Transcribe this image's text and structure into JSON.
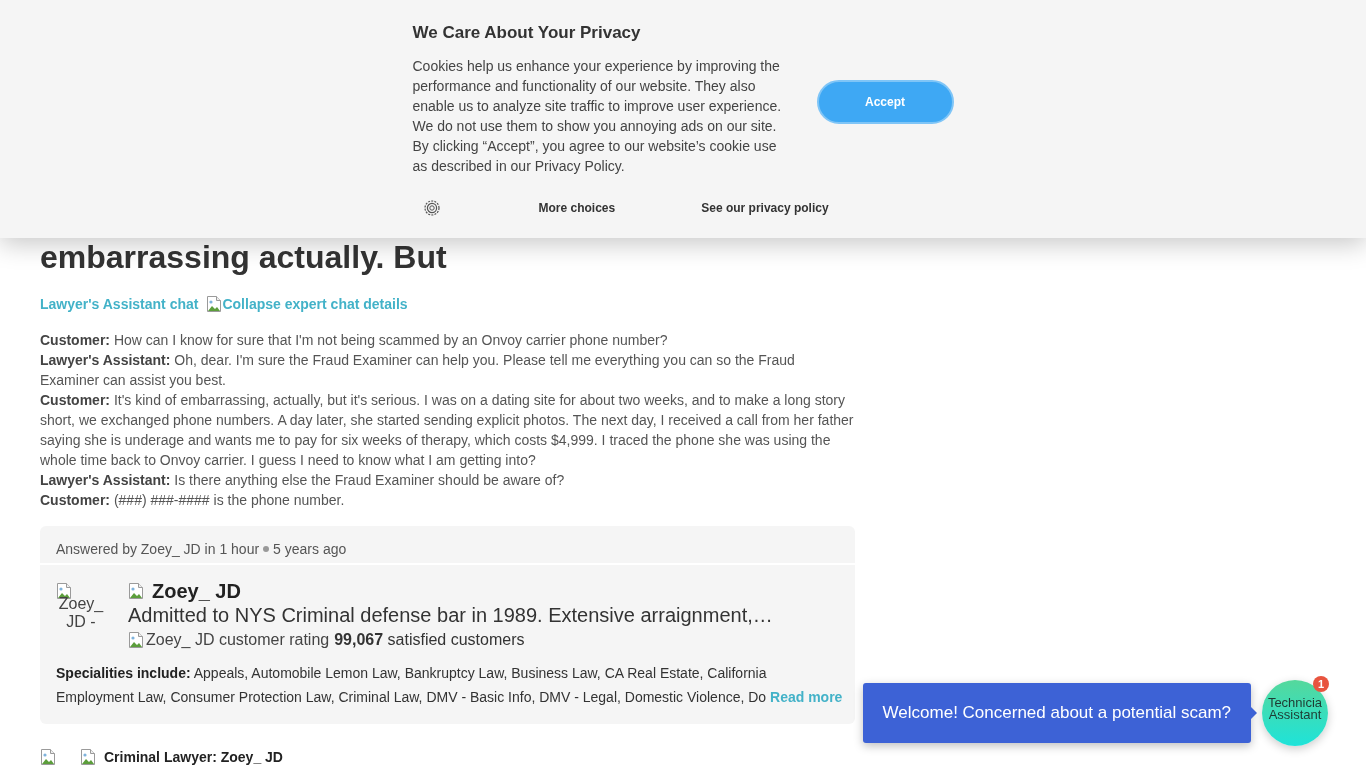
{
  "cookie_banner": {
    "title": "We Care About Your Privacy",
    "body": "Cookies help us enhance your experience by improving the performance and functionality of our website. They also enable us to analyze site traffic to improve user experience. We do not use them to show you annoying ads on our site. By clicking “Accept”, you agree to our website’s cookie use as described in our Privacy Policy.",
    "accept_button": "Accept",
    "links": [
      "More choices",
      "See our privacy policy"
    ]
  },
  "question": {
    "heading": "embarrassing actually. But",
    "chat_link": "Lawyer's Assistant chat",
    "collapse_image_alt": "Collapse expert chat details",
    "transcript": [
      {
        "speaker": "Customer:",
        "text": "How can I know for sure that I'm not being scammed by an Onvoy carrier phone number?"
      },
      {
        "speaker": "Lawyer's Assistant:",
        "text": "Oh, dear. I'm sure the Fraud Examiner can help you. Please tell me everything you can so the Fraud Examiner can assist you best."
      },
      {
        "speaker": "Customer:",
        "text": "It's kind of embarrassing, actually, but it's serious. I was on a dating site for about two weeks, and to make a long story short, we exchanged phone numbers. A day later, she started sending explicit photos. The next day, I received a call from her father saying she is underage and wants me to pay for six weeks of therapy, which costs $4,999. I traced the phone she was using the whole time back to Onvoy carrier. I guess I need to know what I am getting into?"
      },
      {
        "speaker": "Lawyer's Assistant:",
        "text": "Is there anything else the Fraud Examiner should be aware of?"
      },
      {
        "speaker": "Customer:",
        "text": "(###) ###-#### is the phone number."
      }
    ]
  },
  "answer_card": {
    "answered_by": "Answered by Zoey_ JD in 1 hour",
    "age": "5 years ago",
    "avatar_alt": "Zoey_ JD -",
    "expert_name": "Zoey_ JD",
    "tagline": "Admitted to NYS Criminal defense bar in 1989. Extensive arraignment,…",
    "rating_image_alt": "Zoey_ JD customer rating",
    "satisfied": "**99,067** satisfied customers",
    "specialities_label": "Specialities include:",
    "specialities": "Appeals, Automobile Lemon Law, Bankruptcy Law, Business Law, CA Real Estate, California Employment Law, Consumer Protection Law, Criminal Law, DMV - Basic Info, DMV - Legal, Domestic Violence, Do",
    "read_more": "Read more"
  },
  "expert_heading": "Criminal Lawyer: Zoey_ JD",
  "chat_widget": {
    "message": "Welcome! Concerned about a potential scam?",
    "avatar_alt": "Technicia Assistant",
    "badge": "1"
  }
}
